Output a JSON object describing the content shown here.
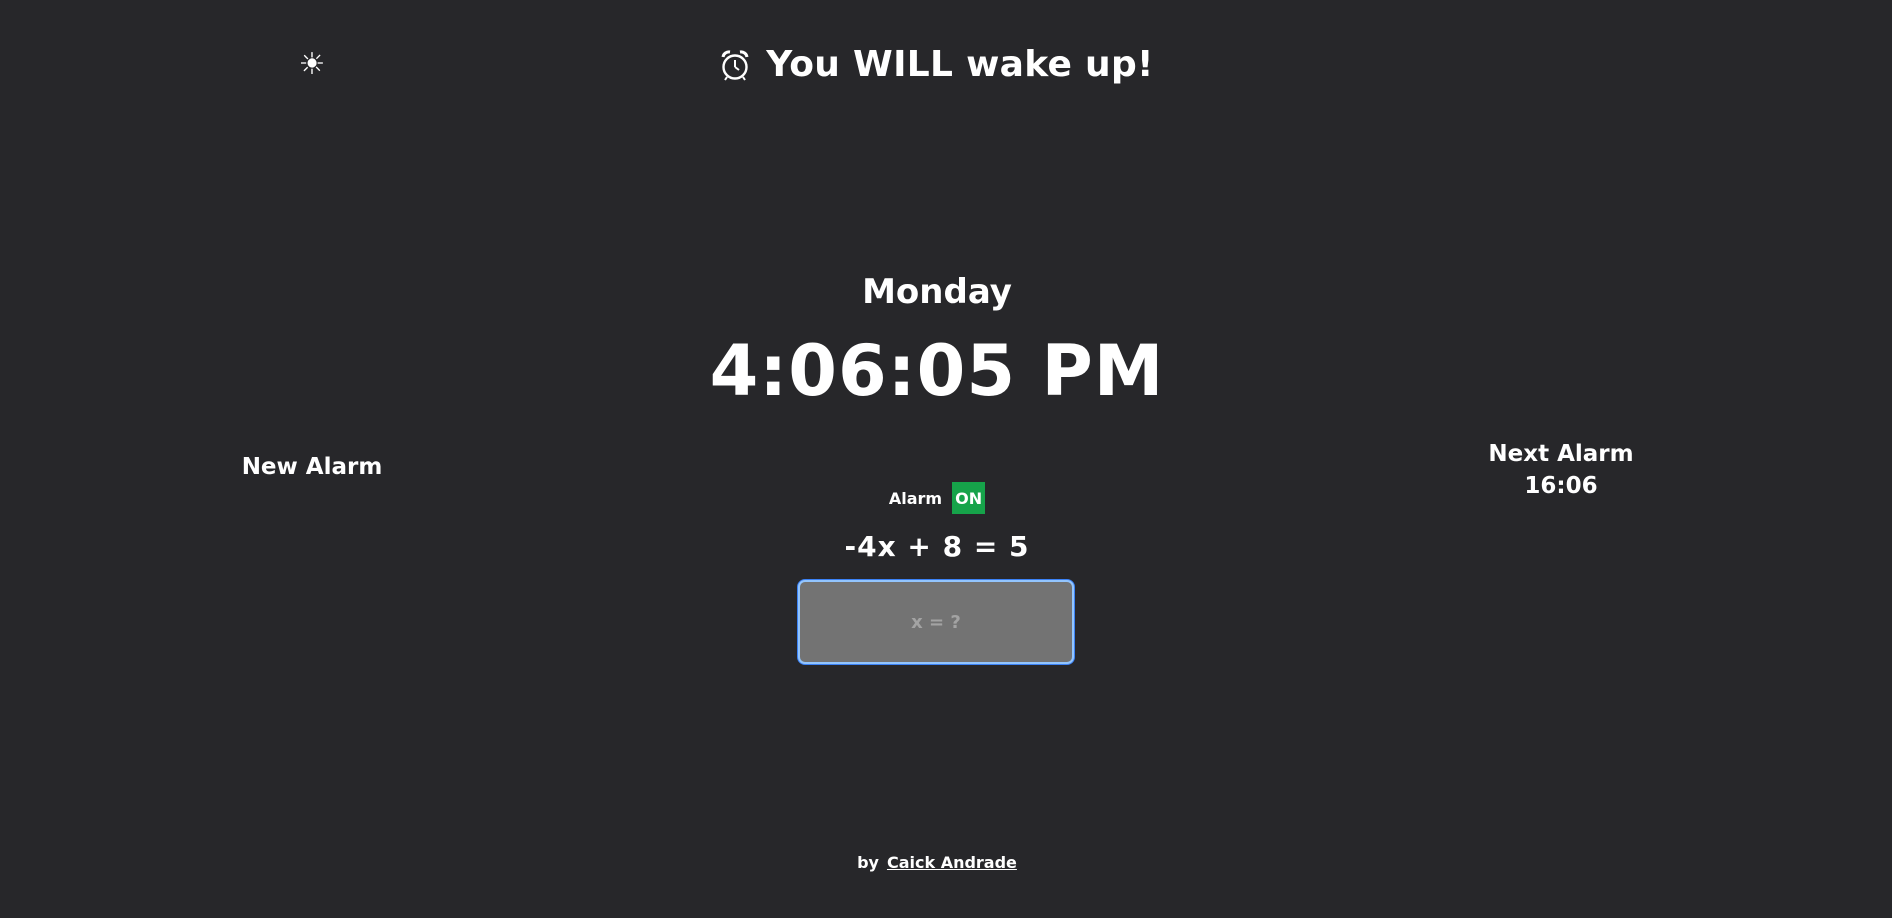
{
  "theme_toggle": {
    "icon": "sun-icon",
    "glyph": "☀"
  },
  "header": {
    "icon": "alarm-clock-icon",
    "title": "You WILL wake up!"
  },
  "clock": {
    "day": "Monday",
    "time": "4:06:05 PM"
  },
  "new_alarm": {
    "label": "New Alarm"
  },
  "next_alarm": {
    "label": "Next Alarm",
    "time": "16:06"
  },
  "alarm_status": {
    "label": "Alarm",
    "state": "ON",
    "state_color": "#16a34a"
  },
  "challenge": {
    "equation": "-4x + 8 = 5",
    "placeholder": "x = ?",
    "value": ""
  },
  "footer": {
    "prefix": "by",
    "author": "Caick Andrade"
  }
}
